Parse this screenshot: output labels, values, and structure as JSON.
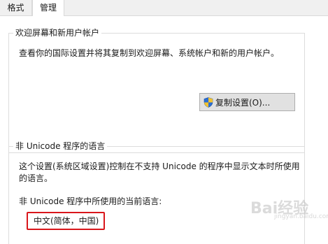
{
  "tabs": [
    {
      "label": "格式"
    },
    {
      "label": "管理"
    }
  ],
  "welcome_group": {
    "title": "欢迎屏幕和新用户帐户",
    "description": "查看你的国际设置并将其复制到欢迎屏幕、系统帐户和新的用户帐户。",
    "copy_button_label": "复制设置(O)..."
  },
  "non_unicode_group": {
    "title": "非 Unicode 程序的语言",
    "description_line1": "这个设置(系统区域设置)控制在不支持 Unicode 的程序中显示文本时所使用",
    "description_line2": "的语言。",
    "current_language_label": "非 Unicode 程序中所使用的当前语言:",
    "current_language_value": "中文(简体，中国)"
  },
  "watermark": {
    "text": "Bai经验",
    "sub": "jingyan.baidu.com"
  },
  "colors": {
    "highlight_border": "#d9161b",
    "button_face": "#e1e1e1"
  }
}
